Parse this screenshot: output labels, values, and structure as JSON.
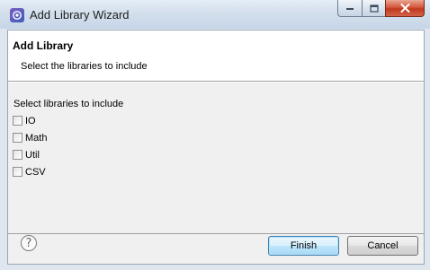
{
  "window": {
    "title": "Add Library Wizard",
    "icon": "eclipse-wizard-icon",
    "controls": {
      "minimize": "minimize-icon",
      "maximize": "maximize-icon",
      "close": "close-icon"
    }
  },
  "header": {
    "title": "Add Library",
    "subtitle": "Select the libraries to include"
  },
  "body": {
    "group_label": "Select libraries to include",
    "libraries": [
      {
        "label": "IO",
        "checked": false
      },
      {
        "label": "Math",
        "checked": false
      },
      {
        "label": "Util",
        "checked": false
      },
      {
        "label": "CSV",
        "checked": false
      }
    ]
  },
  "footer": {
    "help_symbol": "?",
    "finish_label": "Finish",
    "cancel_label": "Cancel"
  },
  "colors": {
    "finish_accent": "#3c7fb1",
    "close_button": "#c0381c"
  }
}
